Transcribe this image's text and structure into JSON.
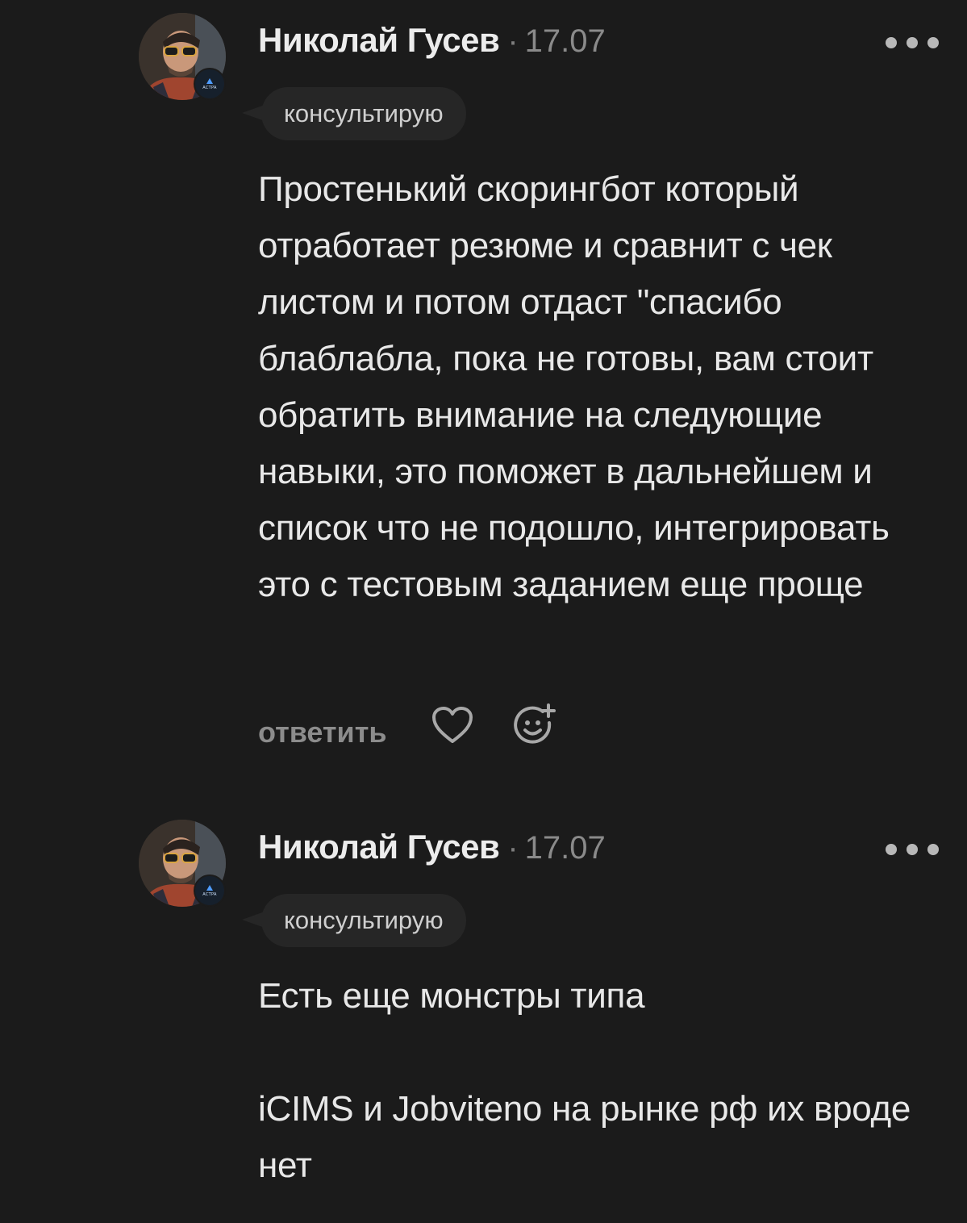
{
  "comments": [
    {
      "author": "Николай Гусев",
      "separator": "·",
      "date": "17.07",
      "tag": "консультирую",
      "badge": "ACTPA",
      "paragraphs": [
        "Простенький скорингбот который отработает резюме и сравнит с чек листом и потом отдаст \"спасибо блаблабла, пока не готовы, вам стоит обратить внимание на следующие навыки, это поможет в дальнейшем и список что не подошло, интегрировать это с тестовым заданием еще проще"
      ],
      "actions": {
        "reply_label": "ответить",
        "like_icon": "heart-icon",
        "react_icon": "emoji-add-icon"
      }
    },
    {
      "author": "Николай Гусев",
      "separator": "·",
      "date": "17.07",
      "tag": "консультирую",
      "badge": "ACTPA",
      "paragraphs": [
        "Есть еще монстры типа",
        "iCIMS и Jobvitеno на рынке рф их вроде нет"
      ]
    }
  ],
  "colors": {
    "background": "#1b1b1b",
    "tag_background": "#262626",
    "text": "#e8e8e8",
    "muted": "#8a8a8a",
    "badge_accent": "#4f9dff"
  }
}
